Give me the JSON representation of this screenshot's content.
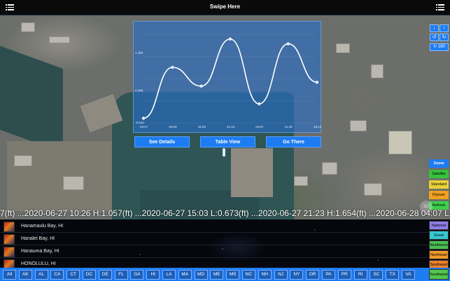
{
  "header": {
    "title": "Swipe Here"
  },
  "chart_data": {
    "type": "line",
    "x": [
      "03:07",
      "09:09",
      "15:03",
      "21:23",
      "04:07",
      "11:39",
      "18:13"
    ],
    "y_labels": [
      "1.490",
      "0.490",
      "-0.510"
    ],
    "values": [
      0.0,
      1.06,
      0.67,
      1.65,
      0.3,
      1.55,
      0.75
    ]
  },
  "buttons": {
    "details": "See Details",
    "table": "Table View",
    "go": "Go There"
  },
  "controls": {
    "rotate_label": "180"
  },
  "layers": {
    "zoom": "Zoom",
    "satellite": "Satellite",
    "standard": "Standard",
    "flyover": "Flyover",
    "refresh": "Refresh"
  },
  "ticker": "7(ft) ...2020-06-27 10:26 H:1.057(ft) ...2020-06-27 15:03 L:0.673(ft) ...2020-06-27 21:23 H:1.654(ft) ...2020-06-28 04:07 L:",
  "compass_label": "3D",
  "list": [
    "Hanamaulu Bay, HI",
    "Hanalei Bay, HI",
    "Hanauma Bay, HI",
    "HONOLULU, HI"
  ],
  "regions": {
    "national": "National",
    "great_lakes": "Great Lake",
    "northwest": "Northwest",
    "northeast": "Northeast",
    "southeast": "Southeast",
    "southwest": "Southwest"
  },
  "colors": {
    "accent": "#1d7cf2",
    "satellite": "#36c23b",
    "standard": "#e8d13a",
    "flyover": "#f0a020",
    "refresh": "#3ecf4c",
    "national": "#8f7ee8",
    "great_lakes": "#37c7d0",
    "northwest": "#4bbf52",
    "northeast": "#f09a28",
    "southeast": "#ef8030",
    "southwest": "#52c64f"
  },
  "states": [
    "All",
    "AK",
    "AL",
    "CA",
    "CT",
    "DC",
    "DE",
    "FL",
    "GA",
    "HI",
    "LA",
    "MA",
    "MD",
    "ME",
    "MS",
    "NC",
    "NH",
    "NJ",
    "NY",
    "OR",
    "PA",
    "PR",
    "RI",
    "SC",
    "TX",
    "VA"
  ]
}
